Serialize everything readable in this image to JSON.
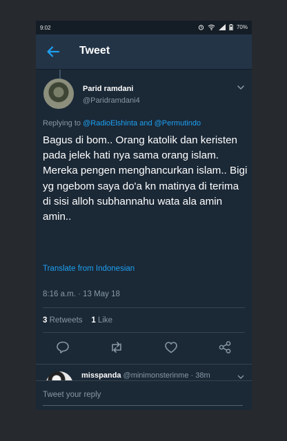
{
  "status_bar": {
    "time": "9:02",
    "battery": "70%"
  },
  "header": {
    "title": "Tweet",
    "back_icon": "back-arrow-icon"
  },
  "tweet": {
    "author_name": "Parid ramdani",
    "author_handle": "@Paridramdani4",
    "replying_prefix": "Replying to",
    "replying_to_1": "@RadioElshinta",
    "replying_and": "and",
    "replying_to_2": "@Permutindo",
    "body": "Bagus di bom.. Orang katolik dan keristen pada jelek hati nya sama orang islam. Mereka pengen menghancurkan islam.. Bigi yg ngebom saya do'a kn matinya di terima di sisi alloh subhannahu wata ala amin amin..",
    "translate_label": "Translate from Indonesian",
    "timestamp": "8:16 a.m. · 13 May 18",
    "retweets_count": "3",
    "retweets_label": "Retweets",
    "likes_count": "1",
    "likes_label": "Like"
  },
  "reply_preview": {
    "name": "misspanda",
    "handle": "@minimonsterinme",
    "time": "· 38m"
  },
  "compose": {
    "placeholder": "Tweet your reply"
  },
  "colors": {
    "background": "#1b2836",
    "header": "#243447",
    "accent": "#1da1f2",
    "secondary_text": "#8899a6"
  }
}
